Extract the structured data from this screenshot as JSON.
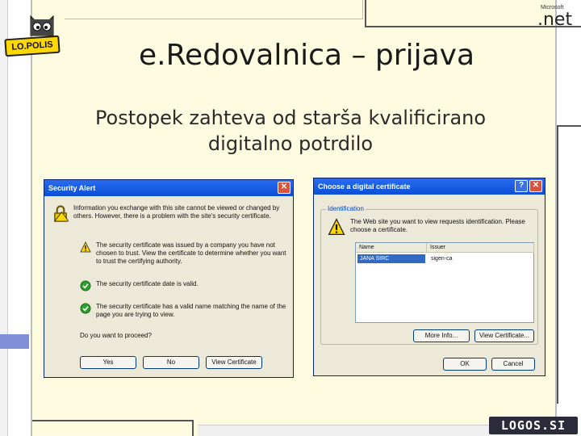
{
  "slide": {
    "title": "e.Redovalnica – prijava",
    "subtitle_line1": "Postopek zahteva od starša kvalificirano",
    "subtitle_line2": "digitalno potrdilo"
  },
  "logos": {
    "lopolis": "LO.POLIS",
    "microsoft": "Microsoft",
    "dotnet": ".net",
    "logos": "LOGOS.SI"
  },
  "security_alert": {
    "title": "Security Alert",
    "intro": "Information you exchange with this site cannot be viewed or changed by others. However, there is a problem with the site's security certificate.",
    "items": [
      {
        "icon": "warning-icon",
        "text": "The security certificate was issued by a company you have not chosen to trust. View the certificate to determine whether you want to trust the certifying authority."
      },
      {
        "icon": "check-icon",
        "text": "The security certificate date is valid."
      },
      {
        "icon": "check-icon",
        "text": "The security certificate has a valid name matching the name of the page you are trying to view."
      }
    ],
    "question": "Do you want to proceed?",
    "buttons": {
      "yes": "Yes",
      "no": "No",
      "view": "View Certificate"
    }
  },
  "choose_cert": {
    "title": "Choose a digital certificate",
    "group_label": "Identification",
    "message": "The Web site you want to view requests identification. Please choose a certificate.",
    "columns": [
      "Name",
      "Issuer"
    ],
    "rows": [
      {
        "name": "JANA SIRC",
        "issuer": "sigen-ca"
      }
    ],
    "buttons": {
      "more_info": "More Info...",
      "view": "View Certificate...",
      "ok": "OK",
      "cancel": "Cancel"
    }
  },
  "colors": {
    "slide_bg": "#fdfce0",
    "xp_titlebar": "#0a4fd6",
    "xp_dialog_bg": "#ece9d8",
    "logos_bar": "#2b2b3a"
  }
}
